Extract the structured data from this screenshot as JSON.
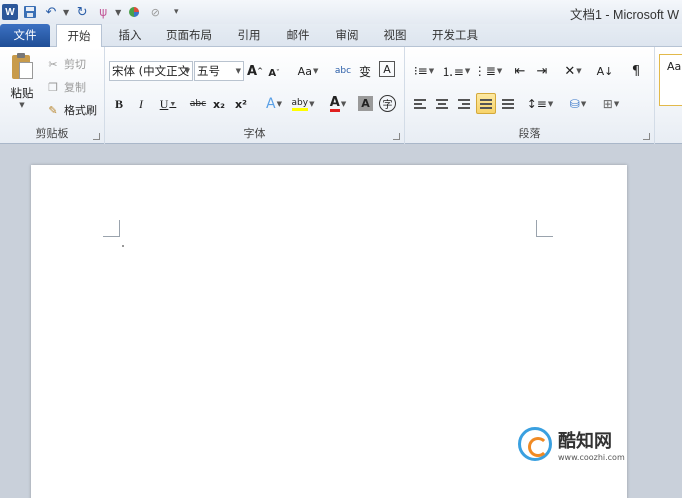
{
  "window": {
    "title": "文档1 - Microsoft W"
  },
  "tabs": [
    "文件",
    "开始",
    "插入",
    "页面布局",
    "引用",
    "邮件",
    "审阅",
    "视图",
    "开发工具"
  ],
  "clipboard": {
    "paste": "粘贴",
    "cut": "剪切",
    "copy": "复制",
    "format_painter": "格式刷",
    "label": "剪贴板"
  },
  "font": {
    "name": "宋体 (中文正文",
    "size": "五号",
    "grow": "A",
    "shrink": "A",
    "case": "Aa",
    "pinyin": "abc",
    "phonetic": "变",
    "border": "A",
    "bold": "B",
    "italic": "I",
    "underline": "U",
    "strike": "abc",
    "subscript": "x₂",
    "superscript": "x²",
    "effects": "A",
    "highlight": "aby",
    "font_color": "A",
    "shading": "A",
    "enclose": "字",
    "label": "字体"
  },
  "paragraph": {
    "label": "段落"
  },
  "styles": {
    "preview": "Aa"
  },
  "watermark": {
    "name": "酷知网",
    "url": "www.coozhi.com"
  }
}
